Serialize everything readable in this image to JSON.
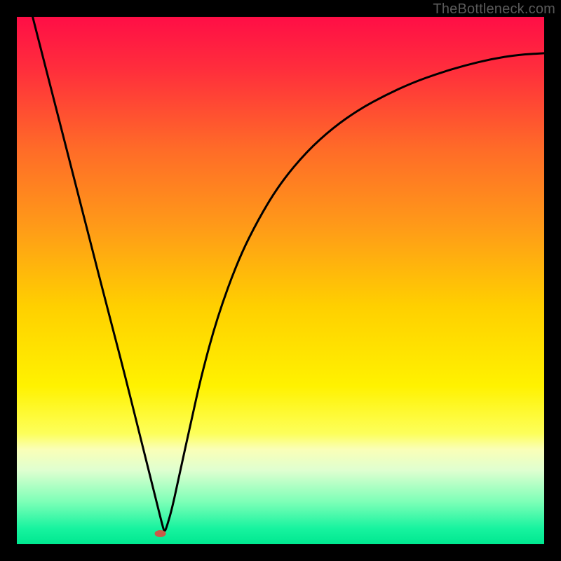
{
  "attribution": "TheBottleneck.com",
  "chart_data": {
    "type": "line",
    "title": "",
    "xlabel": "",
    "ylabel": "",
    "xlim": [
      0,
      100
    ],
    "ylim": [
      0,
      100
    ],
    "background_gradient_stops": [
      {
        "offset": 0.0,
        "color": "#ff0e46"
      },
      {
        "offset": 0.1,
        "color": "#ff2e3c"
      },
      {
        "offset": 0.25,
        "color": "#ff6b28"
      },
      {
        "offset": 0.4,
        "color": "#ff9b18"
      },
      {
        "offset": 0.55,
        "color": "#ffd000"
      },
      {
        "offset": 0.7,
        "color": "#fff200"
      },
      {
        "offset": 0.79,
        "color": "#fdff5a"
      },
      {
        "offset": 0.82,
        "color": "#faffb7"
      },
      {
        "offset": 0.86,
        "color": "#dfffd0"
      },
      {
        "offset": 0.92,
        "color": "#7cffb7"
      },
      {
        "offset": 0.97,
        "color": "#17f39f"
      },
      {
        "offset": 1.0,
        "color": "#00e890"
      }
    ],
    "series": [
      {
        "name": "bottleneck-curve",
        "color": "#000000",
        "x": [
          3.0,
          5.0,
          8.0,
          11.0,
          14.0,
          17.0,
          20.0,
          23.0,
          25.0,
          26.5,
          27.5,
          28.0,
          28.5,
          29.5,
          31.0,
          33.0,
          35.0,
          38.0,
          42.0,
          46.0,
          50.0,
          55.0,
          60.0,
          65.0,
          70.0,
          75.0,
          80.0,
          85.0,
          90.0,
          95.0,
          100.0
        ],
        "y": [
          100.0,
          92.2,
          80.5,
          68.8,
          57.1,
          45.4,
          34.0,
          22.0,
          14.0,
          8.0,
          4.0,
          2.2,
          3.5,
          7.0,
          14.0,
          23.0,
          32.0,
          43.0,
          54.0,
          62.0,
          68.5,
          74.5,
          79.0,
          82.5,
          85.2,
          87.5,
          89.3,
          90.8,
          92.0,
          92.8,
          93.1
        ]
      }
    ],
    "marker": {
      "name": "bottleneck-point",
      "x": 27.2,
      "y": 2.0,
      "color": "#c95a48",
      "rx": 8,
      "ry": 5
    }
  }
}
